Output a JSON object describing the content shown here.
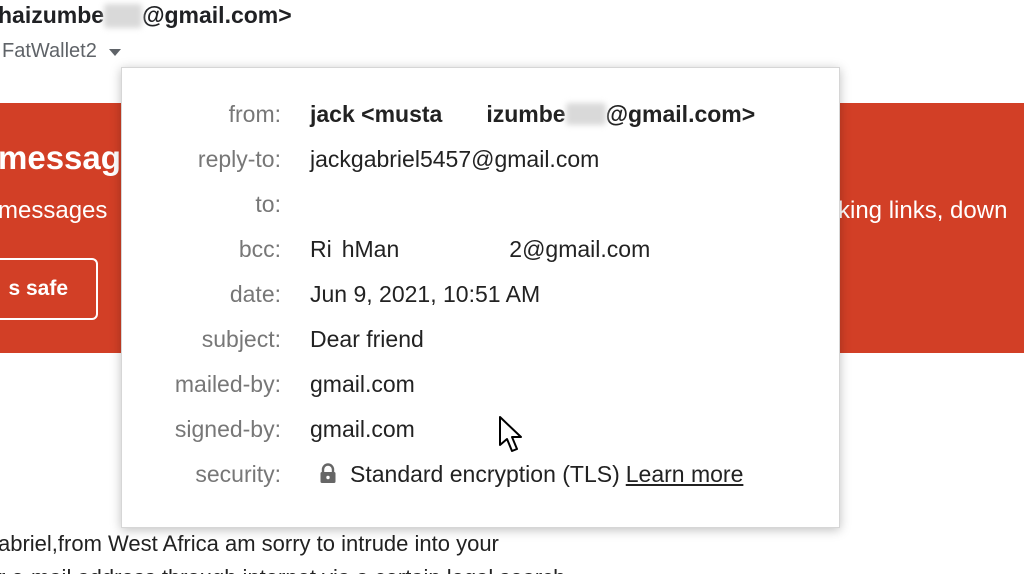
{
  "header": {
    "sender_prefix": "haizumbe",
    "sender_suffix": "@gmail.com>",
    "recipient_label": "FatWallet2"
  },
  "banner": {
    "title": "messag",
    "text_left": "messages",
    "text_right": "king links, down",
    "safe_button_label": "s safe",
    "color": "#d23f26"
  },
  "details": {
    "from": {
      "label": "from:",
      "value_part1": "jack <musta",
      "value_part2": "izumbe",
      "value_part3": "@gmail.com>"
    },
    "reply_to": {
      "label": "reply-to:",
      "value": "jackgabriel5457@gmail.com"
    },
    "to": {
      "label": "to:",
      "value": ""
    },
    "bcc": {
      "label": "bcc:",
      "value_part1": "Ri",
      "value_part2": "hMan",
      "value_part3": "2@gmail.com"
    },
    "date": {
      "label": "date:",
      "value": "Jun 9, 2021, 10:51 AM"
    },
    "subject": {
      "label": "subject:",
      "value": "Dear friend"
    },
    "mailed_by": {
      "label": "mailed-by:",
      "value": "gmail.com"
    },
    "signed_by": {
      "label": "signed-by:",
      "value": "gmail.com"
    },
    "security": {
      "label": "security:",
      "value": "Standard encryption (TLS)",
      "link": "Learn more",
      "icon": "lock-icon"
    }
  },
  "body": {
    "line1": "abriel,from West Africa am sorry to intrude into your",
    "line2": "r e-mail address through internet via a certain legal search"
  }
}
